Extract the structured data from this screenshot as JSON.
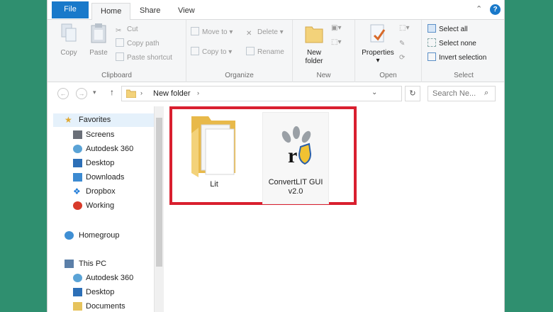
{
  "tabs": {
    "file": "File",
    "home": "Home",
    "share": "Share",
    "view": "View",
    "help": "?"
  },
  "ribbon": {
    "clipboard": {
      "label": "Clipboard",
      "copy": "Copy",
      "paste": "Paste",
      "cut": "Cut",
      "copy_path": "Copy path",
      "paste_shortcut": "Paste shortcut"
    },
    "organize": {
      "label": "Organize",
      "move_to": "Move to",
      "copy_to": "Copy to",
      "delete": "Delete",
      "rename": "Rename"
    },
    "new": {
      "label": "New",
      "new_folder": "New folder"
    },
    "open": {
      "label": "Open",
      "properties": "Properties"
    },
    "select": {
      "label": "Select",
      "select_all": "Select all",
      "select_none": "Select none",
      "invert": "Invert selection"
    }
  },
  "address": {
    "path": "New folder",
    "search_placeholder": "Search Ne..."
  },
  "nav": {
    "favorites": "Favorites",
    "items": [
      "Screens",
      "Autodesk 360",
      "Desktop",
      "Downloads",
      "Dropbox",
      "Working"
    ],
    "homegroup": "Homegroup",
    "thispc": "This PC",
    "pc_items": [
      "Autodesk 360",
      "Desktop",
      "Documents"
    ]
  },
  "files": [
    {
      "name": "Lit",
      "icon": "folder-icon"
    },
    {
      "name_line1": "ConvertLIT GUI",
      "name_line2": "v2.0",
      "icon": "app-icon"
    }
  ],
  "colors": {
    "file_tab": "#1979ca",
    "highlight": "#d91f2f",
    "background": "#2f8f6f",
    "folder": "#f3d27a"
  }
}
